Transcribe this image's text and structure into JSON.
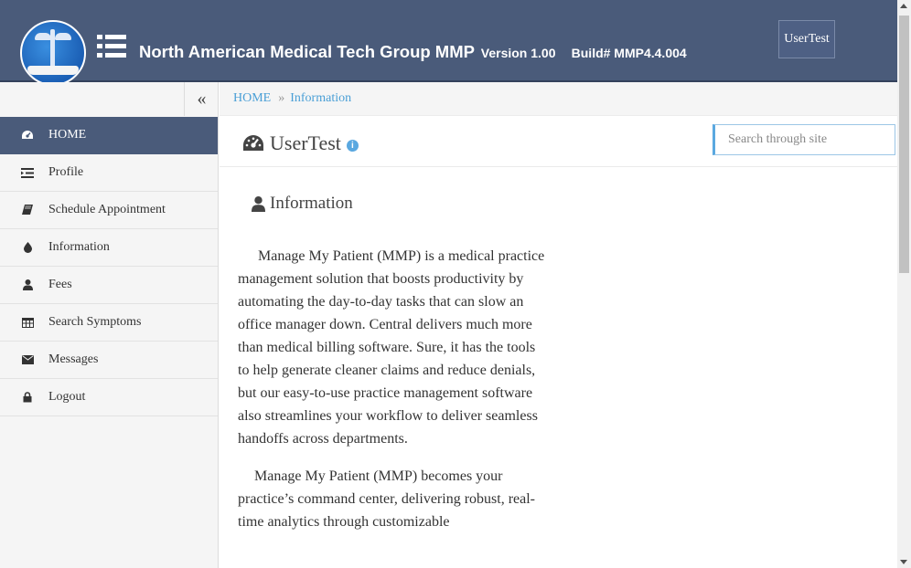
{
  "header": {
    "app_name": "North American Medical Tech Group MMP",
    "version": "Version 1.00",
    "build": "Build# MMP4.4.004",
    "user_button": "UserTest"
  },
  "sidebar": {
    "collapse_icon": "double-chevron-left-icon",
    "items": [
      {
        "label": "HOME",
        "icon": "dashboard-icon",
        "active": true
      },
      {
        "label": "Profile",
        "icon": "list-indent-icon"
      },
      {
        "label": "Schedule Appointment",
        "icon": "book-icon"
      },
      {
        "label": "Information",
        "icon": "droplet-icon"
      },
      {
        "label": "Fees",
        "icon": "user-icon"
      },
      {
        "label": "Search Symptoms",
        "icon": "table-icon"
      },
      {
        "label": "Messages",
        "icon": "envelope-icon"
      },
      {
        "label": "Logout",
        "icon": "lock-icon"
      }
    ]
  },
  "breadcrumb": {
    "home": "HOME",
    "separator": "»",
    "current": "Information"
  },
  "search": {
    "placeholder": "Search through site"
  },
  "page": {
    "title": "UserTest",
    "title_icon": "dashboard-icon",
    "info_icon": "info-circle-icon",
    "section_title": "Information",
    "section_icon": "user-icon",
    "paragraphs": [
      "Manage My Patient (MMP) is a medical practice management solution that boosts productivity by automating the day-to-day tasks that can slow an office manager down. Central delivers much more than medical billing software. Sure, it has the tools to help generate cleaner claims and reduce denials, but our easy-to-use practice management software also streamlines your workflow to deliver seamless handoffs across departments.",
      "Manage My Patient (MMP) becomes your practice’s command center, delivering robust, real-time analytics through customizable"
    ]
  },
  "colors": {
    "header_bg": "#4a5b7a",
    "active_nav_bg": "#4a5b7a",
    "link": "#4a9fd6"
  }
}
